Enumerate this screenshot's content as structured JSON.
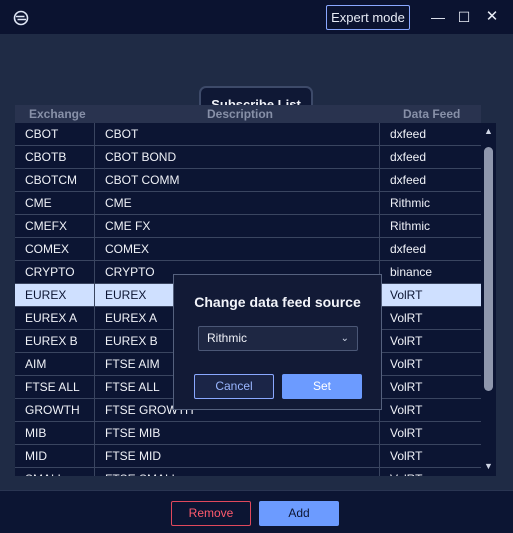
{
  "window": {
    "expert_mode_label": "Expert mode",
    "minimize_glyph": "—",
    "maximize_glyph": "☐",
    "close_glyph": "✕"
  },
  "subscribe_list_label": "Subscribe List",
  "table": {
    "headers": {
      "exchange": "Exchange",
      "description": "Description",
      "data_feed": "Data Feed"
    },
    "rows": [
      {
        "exchange": "CBOT",
        "description": "CBOT",
        "data_feed": "dxfeed"
      },
      {
        "exchange": "CBOTB",
        "description": "CBOT BOND",
        "data_feed": "dxfeed"
      },
      {
        "exchange": "CBOTCM",
        "description": "CBOT COMM",
        "data_feed": "dxfeed"
      },
      {
        "exchange": "CME",
        "description": "CME",
        "data_feed": "Rithmic"
      },
      {
        "exchange": "CMEFX",
        "description": "CME FX",
        "data_feed": "Rithmic"
      },
      {
        "exchange": "COMEX",
        "description": "COMEX",
        "data_feed": "dxfeed"
      },
      {
        "exchange": "CRYPTO",
        "description": "CRYPTO",
        "data_feed": "binance"
      },
      {
        "exchange": "EUREX",
        "description": "EUREX",
        "data_feed": "VolRT",
        "selected": true
      },
      {
        "exchange": "EUREX A",
        "description": "EUREX A",
        "data_feed": "VolRT"
      },
      {
        "exchange": "EUREX B",
        "description": "EUREX B",
        "data_feed": "VolRT"
      },
      {
        "exchange": "AIM",
        "description": "FTSE AIM",
        "data_feed": "VolRT"
      },
      {
        "exchange": "FTSE ALL",
        "description": "FTSE ALL",
        "data_feed": "VolRT"
      },
      {
        "exchange": "GROWTH",
        "description": "FTSE GROWTH",
        "data_feed": "VolRT"
      },
      {
        "exchange": "MIB",
        "description": "FTSE MIB",
        "data_feed": "VolRT"
      },
      {
        "exchange": "MID",
        "description": "FTSE MID",
        "data_feed": "VolRT"
      },
      {
        "exchange": "SMALL",
        "description": "FTSE SMALL",
        "data_feed": "VolRT"
      }
    ]
  },
  "dialog": {
    "title": "Change data feed source",
    "selected_feed": "Rithmic",
    "cancel_label": "Cancel",
    "set_label": "Set"
  },
  "footer": {
    "remove_label": "Remove",
    "add_label": "Add"
  },
  "colors": {
    "background": "#0c1533",
    "panel": "#1f2b45",
    "accent": "#6c9bff",
    "selected_row": "#cfe0ff",
    "danger": "#e0485c"
  }
}
